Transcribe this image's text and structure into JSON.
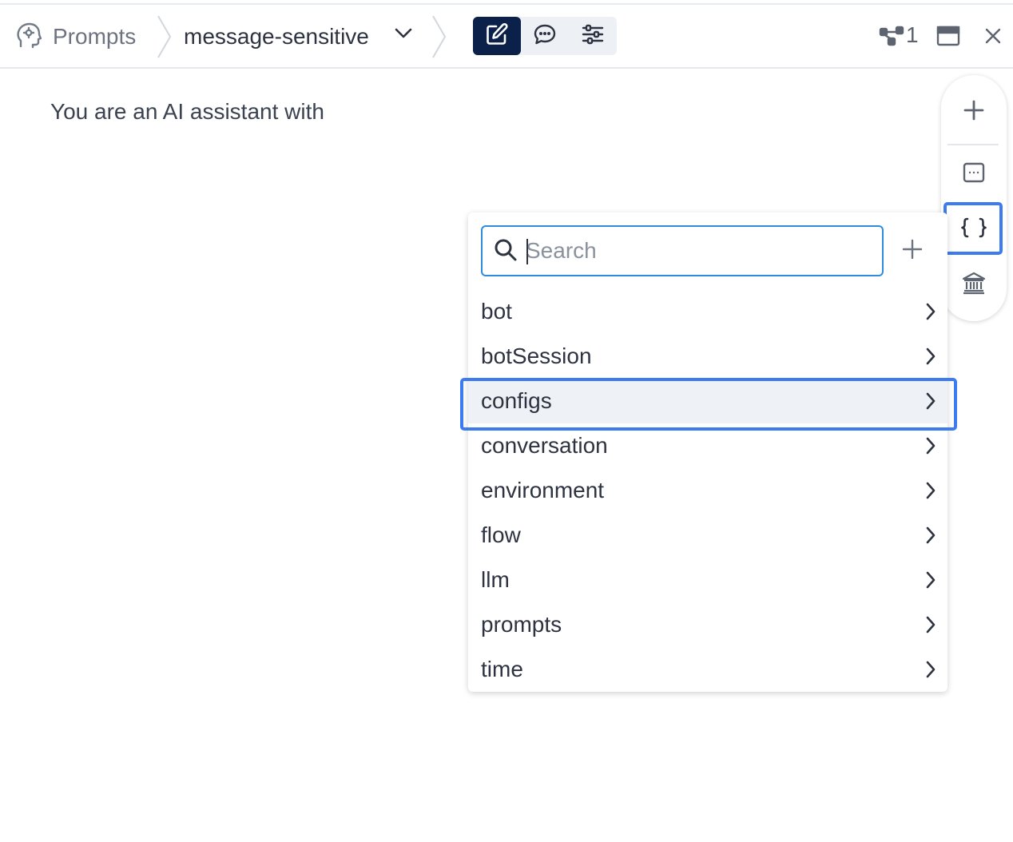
{
  "header": {
    "section_label": "Prompts",
    "prompt_name": "message-sensitive",
    "modes": [
      {
        "name": "edit",
        "icon": "edit-icon",
        "active": true
      },
      {
        "name": "chat",
        "icon": "chat-icon",
        "active": false
      },
      {
        "name": "settings",
        "icon": "sliders-icon",
        "active": false
      }
    ],
    "flow_count": "1",
    "colors": {
      "active_mode_bg": "#0c2149",
      "highlight": "#3d7bf0",
      "search_border": "#2e8bde"
    }
  },
  "editor": {
    "content": "You are an AI assistant with"
  },
  "side_toolbar": {
    "buttons": [
      "add-icon",
      "snippet-icon",
      "variables-icon",
      "library-icon"
    ],
    "active": "variables-icon"
  },
  "variables_menu": {
    "search_placeholder": "Search",
    "search_value": "",
    "items": [
      {
        "label": "bot"
      },
      {
        "label": "botSession"
      },
      {
        "label": "configs"
      },
      {
        "label": "conversation"
      },
      {
        "label": "environment"
      },
      {
        "label": "flow"
      },
      {
        "label": "llm"
      },
      {
        "label": "prompts"
      },
      {
        "label": "time"
      }
    ],
    "selected_label": "configs"
  }
}
